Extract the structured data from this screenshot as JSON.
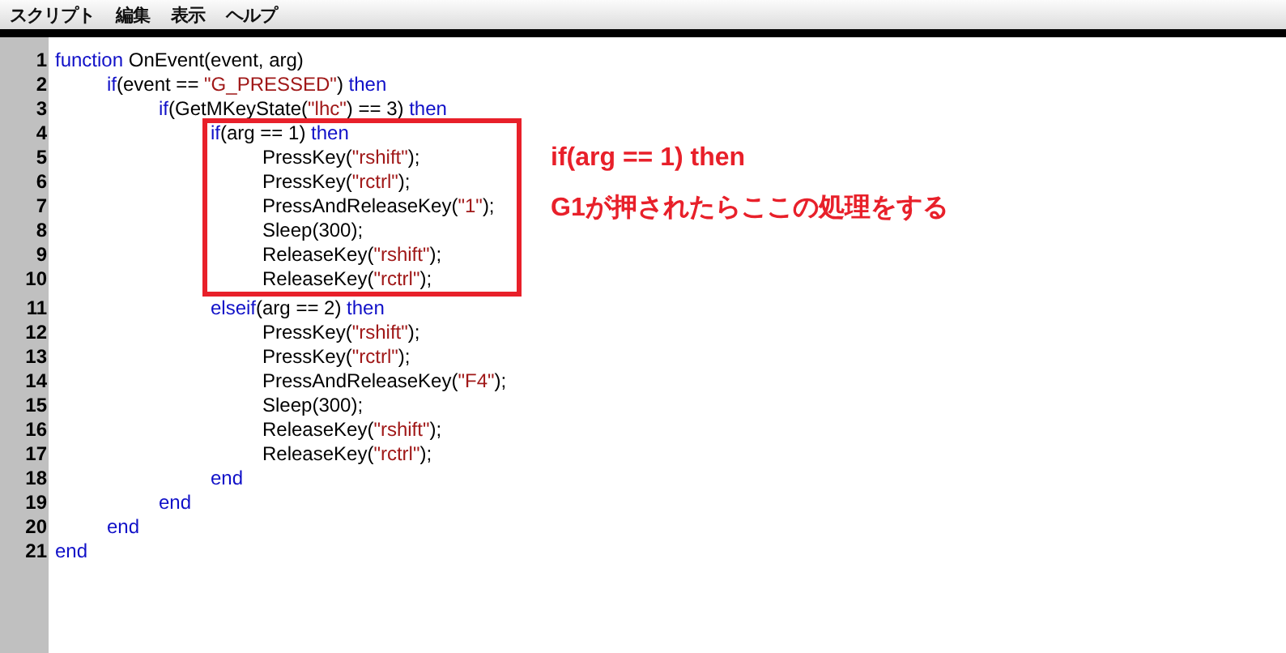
{
  "menu": [
    {
      "label": "スクリプト"
    },
    {
      "label": "編集"
    },
    {
      "label": "表示"
    },
    {
      "label": "ヘルプ"
    }
  ],
  "editor": {
    "lines": [
      {
        "number": "1",
        "framed": false,
        "tokens": [
          {
            "kind": "keyword",
            "text": "function"
          },
          {
            "kind": "plain",
            "text": " OnEvent(event, arg)"
          }
        ],
        "children": [
          {
            "number": "2",
            "framed": false,
            "tokens": [
              {
                "kind": "keyword",
                "text": "if"
              },
              {
                "kind": "plain",
                "text": "(event == "
              },
              {
                "kind": "string",
                "text": "\"G_PRESSED\""
              },
              {
                "kind": "plain",
                "text": ") "
              },
              {
                "kind": "keyword",
                "text": "then"
              }
            ],
            "children": [
              {
                "number": "3",
                "framed": false,
                "tokens": [
                  {
                    "kind": "keyword",
                    "text": "if"
                  },
                  {
                    "kind": "plain",
                    "text": "(GetMKeyState("
                  },
                  {
                    "kind": "string",
                    "text": "\"lhc\""
                  },
                  {
                    "kind": "plain",
                    "text": ") == 3) "
                  },
                  {
                    "kind": "keyword",
                    "text": "then"
                  }
                ],
                "children": [
                  {
                    "number": "4",
                    "framed": true,
                    "tokens": [
                      {
                        "kind": "keyword",
                        "text": "if"
                      },
                      {
                        "kind": "plain",
                        "text": "(arg == 1) "
                      },
                      {
                        "kind": "keyword",
                        "text": "then"
                      }
                    ],
                    "children": [
                      {
                        "number": "5",
                        "framed": false,
                        "tokens": [
                          {
                            "kind": "plain",
                            "text": "PressKey("
                          },
                          {
                            "kind": "string",
                            "text": "\"rshift\""
                          },
                          {
                            "kind": "plain",
                            "text": ");"
                          }
                        ]
                      },
                      {
                        "number": "6",
                        "framed": false,
                        "tokens": [
                          {
                            "kind": "plain",
                            "text": "PressKey("
                          },
                          {
                            "kind": "string",
                            "text": "\"rctrl\""
                          },
                          {
                            "kind": "plain",
                            "text": ");"
                          }
                        ]
                      },
                      {
                        "number": "7",
                        "framed": false,
                        "tokens": [
                          {
                            "kind": "plain",
                            "text": "PressAndReleaseKey("
                          },
                          {
                            "kind": "string",
                            "text": "\"1\""
                          },
                          {
                            "kind": "plain",
                            "text": ");"
                          }
                        ]
                      },
                      {
                        "number": "8",
                        "framed": false,
                        "tokens": [
                          {
                            "kind": "plain",
                            "text": "Sleep(300);"
                          }
                        ]
                      },
                      {
                        "number": "9",
                        "framed": false,
                        "tokens": [
                          {
                            "kind": "plain",
                            "text": "ReleaseKey("
                          },
                          {
                            "kind": "string",
                            "text": "\"rshift\""
                          },
                          {
                            "kind": "plain",
                            "text": ");"
                          }
                        ]
                      },
                      {
                        "number": "10",
                        "framed": false,
                        "tokens": [
                          {
                            "kind": "plain",
                            "text": "ReleaseKey("
                          },
                          {
                            "kind": "string",
                            "text": "\"rctrl\""
                          },
                          {
                            "kind": "plain",
                            "text": ");"
                          }
                        ]
                      }
                    ]
                  },
                  {
                    "number": "11",
                    "framed": false,
                    "tokens": [
                      {
                        "kind": "keyword",
                        "text": "elseif"
                      },
                      {
                        "kind": "plain",
                        "text": "(arg == 2) "
                      },
                      {
                        "kind": "keyword",
                        "text": "then"
                      }
                    ],
                    "children": [
                      {
                        "number": "12",
                        "framed": false,
                        "tokens": [
                          {
                            "kind": "plain",
                            "text": "PressKey("
                          },
                          {
                            "kind": "string",
                            "text": "\"rshift\""
                          },
                          {
                            "kind": "plain",
                            "text": ");"
                          }
                        ]
                      },
                      {
                        "number": "13",
                        "framed": false,
                        "tokens": [
                          {
                            "kind": "plain",
                            "text": "PressKey("
                          },
                          {
                            "kind": "string",
                            "text": "\"rctrl\""
                          },
                          {
                            "kind": "plain",
                            "text": ");"
                          }
                        ]
                      },
                      {
                        "number": "14",
                        "framed": false,
                        "tokens": [
                          {
                            "kind": "plain",
                            "text": "PressAndReleaseKey("
                          },
                          {
                            "kind": "string",
                            "text": "\"F4\""
                          },
                          {
                            "kind": "plain",
                            "text": ");"
                          }
                        ]
                      },
                      {
                        "number": "15",
                        "framed": false,
                        "tokens": [
                          {
                            "kind": "plain",
                            "text": "Sleep(300);"
                          }
                        ]
                      },
                      {
                        "number": "16",
                        "framed": false,
                        "tokens": [
                          {
                            "kind": "plain",
                            "text": "ReleaseKey("
                          },
                          {
                            "kind": "string",
                            "text": "\"rshift\""
                          },
                          {
                            "kind": "plain",
                            "text": ");"
                          }
                        ]
                      },
                      {
                        "number": "17",
                        "framed": false,
                        "tokens": [
                          {
                            "kind": "plain",
                            "text": "ReleaseKey("
                          },
                          {
                            "kind": "string",
                            "text": "\"rctrl\""
                          },
                          {
                            "kind": "plain",
                            "text": ");"
                          }
                        ]
                      }
                    ]
                  },
                  {
                    "number": "18",
                    "framed": false,
                    "tokens": [
                      {
                        "kind": "keyword",
                        "text": "end"
                      }
                    ]
                  }
                ]
              },
              {
                "number": "19",
                "framed": false,
                "tokens": [
                  {
                    "kind": "keyword",
                    "text": "end"
                  }
                ]
              }
            ]
          },
          {
            "number": "20",
            "framed": false,
            "tokens": [
              {
                "kind": "keyword",
                "text": "end"
              }
            ]
          }
        ]
      },
      {
        "number": "21",
        "framed": false,
        "tokens": [
          {
            "kind": "keyword",
            "text": "end"
          }
        ]
      }
    ]
  },
  "annotation": {
    "lines": [
      "if(arg == 1) then",
      "G1が押されたらここの処理をする"
    ]
  }
}
